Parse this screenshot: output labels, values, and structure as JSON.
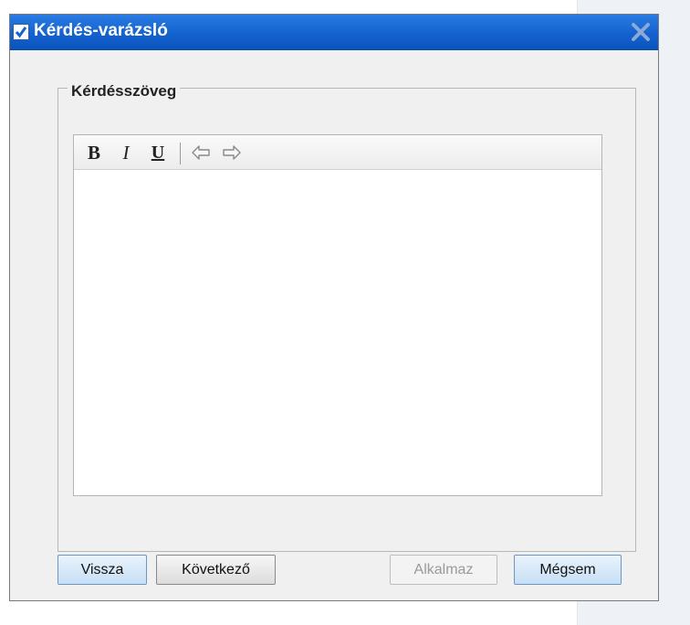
{
  "dialog": {
    "title": "Kérdés-varázsló",
    "group_label": "Kérdésszöveg",
    "editor": {
      "toolbar": {
        "bold_label": "B",
        "italic_label": "I",
        "underline_label": "U",
        "undo_icon": "undo-arrow-icon",
        "redo_icon": "redo-arrow-icon"
      },
      "content": ""
    },
    "buttons": {
      "back": "Vissza",
      "next": "Következő",
      "apply": "Alkalmaz",
      "cancel": "Mégsem"
    }
  },
  "colors": {
    "titlebar": "#1462cf",
    "dialog_bg": "#f0f0f0",
    "side_panel": "#eef1f5",
    "primary_button": "#c6dff5"
  }
}
